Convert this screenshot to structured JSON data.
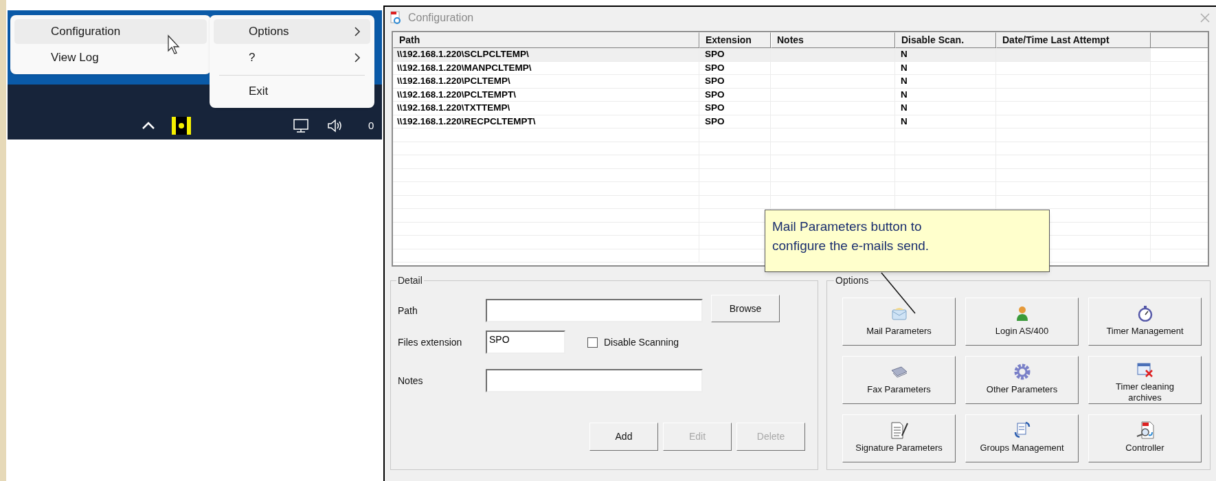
{
  "tray_menu": {
    "items": [
      {
        "label": "Configuration",
        "selected": true
      },
      {
        "label": "View Log",
        "selected": false
      }
    ]
  },
  "submenu": {
    "items": [
      {
        "label": "Options",
        "kind": "submenu",
        "selected": true,
        "separator_before": false
      },
      {
        "label": "?",
        "kind": "submenu",
        "selected": false,
        "separator_before": false
      },
      {
        "label": "Exit",
        "kind": "item",
        "selected": false,
        "separator_before": true
      }
    ]
  },
  "taskbar": {
    "clock": "0"
  },
  "window": {
    "title": "Configuration"
  },
  "table": {
    "columns": [
      "Path",
      "Extension",
      "Notes",
      "Disable Scan.",
      "Date/Time Last Attempt"
    ],
    "rows": [
      {
        "path": "\\\\192.168.1.220\\SCLPCLTEMP\\",
        "extension": "SPO",
        "disable_scan": "N",
        "selected": true
      },
      {
        "path": "\\\\192.168.1.220\\MANPCLTEMP\\",
        "extension": "SPO",
        "disable_scan": "N",
        "selected": false
      },
      {
        "path": "\\\\192.168.1.220\\PCLTEMP\\",
        "extension": "SPO",
        "disable_scan": "N",
        "selected": false
      },
      {
        "path": "\\\\192.168.1.220\\PCLTEMPT\\",
        "extension": "SPO",
        "disable_scan": "N",
        "selected": false
      },
      {
        "path": "\\\\192.168.1.220\\TXTTEMP\\",
        "extension": "SPO",
        "disable_scan": "N",
        "selected": false
      },
      {
        "path": "\\\\192.168.1.220\\RECPCLTEMPT\\",
        "extension": "SPO",
        "disable_scan": "N",
        "selected": false
      }
    ]
  },
  "callout": {
    "lines": [
      "Mail Parameters button to",
      "configure the e-mails send."
    ]
  },
  "detail": {
    "title": "Detail",
    "path": {
      "label": "Path"
    },
    "browse": "Browse",
    "files_extension": {
      "label": "Files extension",
      "value": "SPO"
    },
    "disable_scanning": {
      "label": "Disable Scanning",
      "checked": false
    },
    "notes": {
      "label": "Notes"
    },
    "buttons": [
      {
        "label": "Add",
        "disabled": false
      },
      {
        "label": "Edit",
        "disabled": true
      },
      {
        "label": "Delete",
        "disabled": true
      }
    ]
  },
  "options": {
    "title": "Options",
    "buttons": [
      {
        "label": "Mail Parameters",
        "kind": "mail"
      },
      {
        "label": "Login AS/400",
        "kind": "login"
      },
      {
        "label": "Timer Management",
        "kind": "timer"
      },
      {
        "label": "Fax Parameters",
        "kind": "fax"
      },
      {
        "label": "Other Parameters",
        "kind": "gear"
      },
      {
        "label": "Timer cleaning archives",
        "kind": "cleaning"
      },
      {
        "label": "Signature Parameters",
        "kind": "signature"
      },
      {
        "label": "Groups Management",
        "kind": "groups"
      },
      {
        "label": "Controller",
        "kind": "controller"
      }
    ]
  }
}
